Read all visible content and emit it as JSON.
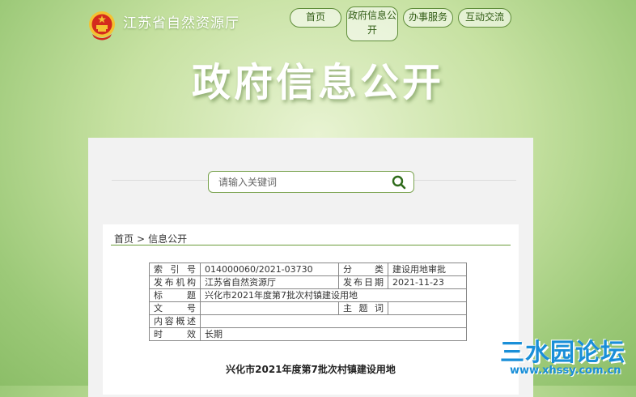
{
  "header": {
    "site_title": "江苏省自然资源厅",
    "nav": [
      {
        "label": "首页"
      },
      {
        "label_line1": "政府信息公",
        "label_line2": "开"
      },
      {
        "label": "办事服务"
      },
      {
        "label": "互动交流"
      }
    ]
  },
  "banner": {
    "title": "政府信息公开"
  },
  "search": {
    "placeholder": "请输入关键词"
  },
  "breadcrumb": {
    "home": "首页",
    "separator": ">",
    "current": "信息公开"
  },
  "meta": {
    "index_label": "索引号",
    "index_value": "014000060/2021-03730",
    "category_label": "分类",
    "category_value": "建设用地审批",
    "publisher_label": "发布机构",
    "publisher_value": "江苏省自然资源厅",
    "date_label": "发布日期",
    "date_value": "2021-11-23",
    "title_label": "标题",
    "title_value": "兴化市2021年度第7批次村镇建设用地",
    "docno_label": "文号",
    "docno_value": "",
    "topic_label": "主题词",
    "topic_value": "",
    "summary_label": "内容概述",
    "summary_value": "",
    "validity_label": "时效",
    "validity_value": "长期"
  },
  "document": {
    "title": "兴化市2021年度第7批次村镇建设用地"
  },
  "watermark": {
    "main": "三水园论坛",
    "url": "www.xhssy.com.cn"
  },
  "colors": {
    "accent_green": "#6b9c39",
    "watermark_blue": "#1a8fd8",
    "emblem_red": "#d42a1d",
    "emblem_gold": "#f4c232"
  },
  "icons": {
    "emblem": "national-emblem-icon",
    "search": "search-icon"
  }
}
